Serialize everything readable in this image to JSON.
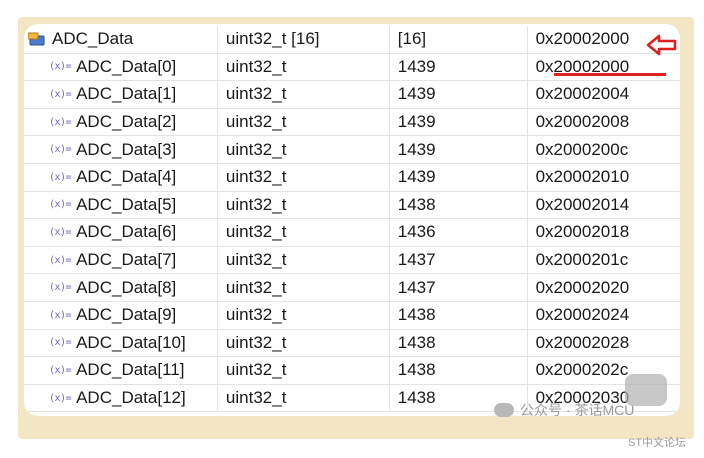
{
  "variables": {
    "parent": {
      "name": "ADC_Data",
      "type": "uint32_t [16]",
      "value": "[16]",
      "location": "0x20002000"
    },
    "children": [
      {
        "name": "ADC_Data[0]",
        "type": "uint32_t",
        "value": "1439",
        "location": "0x20002000"
      },
      {
        "name": "ADC_Data[1]",
        "type": "uint32_t",
        "value": "1439",
        "location": "0x20002004"
      },
      {
        "name": "ADC_Data[2]",
        "type": "uint32_t",
        "value": "1439",
        "location": "0x20002008"
      },
      {
        "name": "ADC_Data[3]",
        "type": "uint32_t",
        "value": "1439",
        "location": "0x2000200c"
      },
      {
        "name": "ADC_Data[4]",
        "type": "uint32_t",
        "value": "1439",
        "location": "0x20002010"
      },
      {
        "name": "ADC_Data[5]",
        "type": "uint32_t",
        "value": "1438",
        "location": "0x20002014"
      },
      {
        "name": "ADC_Data[6]",
        "type": "uint32_t",
        "value": "1436",
        "location": "0x20002018"
      },
      {
        "name": "ADC_Data[7]",
        "type": "uint32_t",
        "value": "1437",
        "location": "0x2000201c"
      },
      {
        "name": "ADC_Data[8]",
        "type": "uint32_t",
        "value": "1437",
        "location": "0x20002020"
      },
      {
        "name": "ADC_Data[9]",
        "type": "uint32_t",
        "value": "1438",
        "location": "0x20002024"
      },
      {
        "name": "ADC_Data[10]",
        "type": "uint32_t",
        "value": "1438",
        "location": "0x20002028"
      },
      {
        "name": "ADC_Data[11]",
        "type": "uint32_t",
        "value": "1438",
        "location": "0x2000202c"
      },
      {
        "name": "ADC_Data[12]",
        "type": "uint32_t",
        "value": "1438",
        "location": "0x20002030"
      }
    ]
  },
  "icons": {
    "parent": "array-variable-icon",
    "child": "variable-icon",
    "child_glyph": "(x)="
  },
  "annotation": {
    "color": "#e02020",
    "marker": "arrow-left-icon"
  },
  "watermark": {
    "text": "公众号 · 茶话MCU",
    "subtext": "ST中文论坛"
  }
}
